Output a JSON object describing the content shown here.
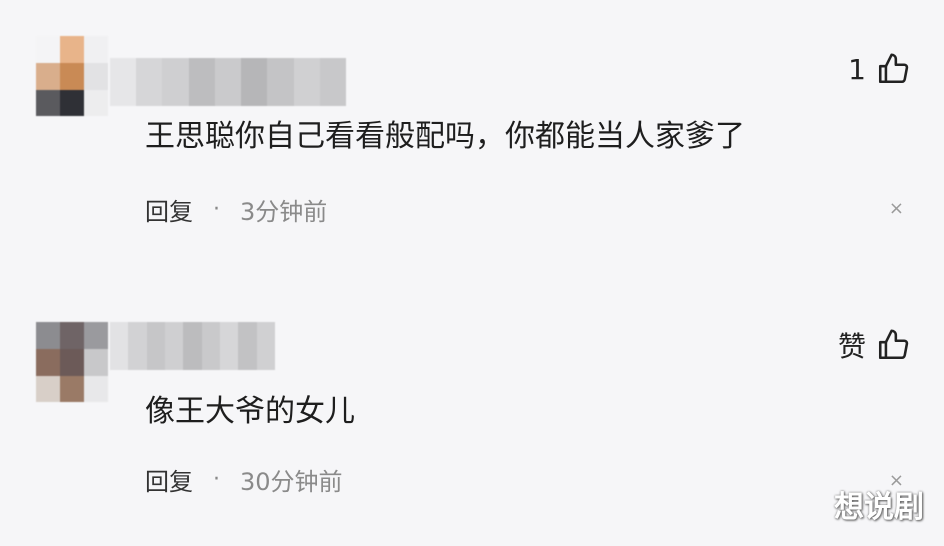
{
  "comments": [
    {
      "like_label": "1",
      "text": "王思聪你自己看看般配吗，你都能当人家爹了",
      "reply_label": "回复",
      "separator": "·",
      "time": "3分钟前",
      "close_glyph": "×",
      "icons": {
        "like": "thumbs-up-icon",
        "close": "close-icon"
      }
    },
    {
      "like_label": "赞",
      "text": "像王大爷的女儿",
      "reply_label": "回复",
      "separator": "·",
      "time": "30分钟前",
      "close_glyph": "×",
      "icons": {
        "like": "thumbs-up-icon",
        "close": "close-icon"
      }
    }
  ],
  "watermark": "想说剧"
}
